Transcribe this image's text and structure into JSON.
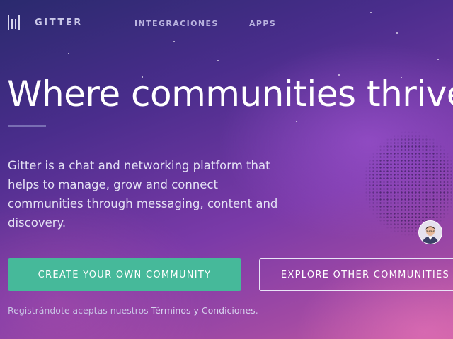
{
  "header": {
    "logo_text": "GITTER",
    "nav": [
      {
        "label": "INTEGRACIONES"
      },
      {
        "label": "APPS"
      }
    ]
  },
  "hero": {
    "title": "Where communities thrive",
    "description": "Gitter is a chat and networking platform that helps to manage, grow and connect communities through messaging, content and discovery.",
    "primary_button": "CREATE YOUR OWN COMMUNITY",
    "secondary_button": "EXPLORE OTHER COMMUNITIES",
    "terms_prefix": "Registrándote aceptas nuestros ",
    "terms_link": "Términos y Condiciones",
    "terms_suffix": "."
  },
  "colors": {
    "primary_button": "#46b99a",
    "background_top": "#2a2a6e",
    "background_bottom": "#c45aa0"
  },
  "icons": [
    "gitter-logo-icon",
    "user-avatar"
  ]
}
